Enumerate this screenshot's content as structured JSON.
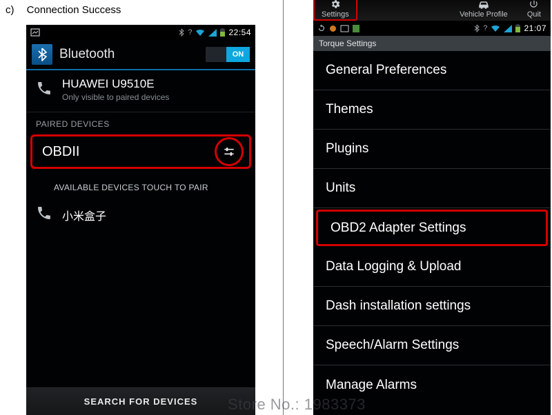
{
  "label": {
    "letter": "c)",
    "text": "Connection Success"
  },
  "dock": {
    "settings": "Settings",
    "vehicle": "Vehicle Profile",
    "quit": "Quit"
  },
  "left": {
    "status": {
      "time": "22:54"
    },
    "bt_title": "Bluetooth",
    "toggle": "ON",
    "visibility": {
      "name": "HUAWEI U9510E",
      "sub": "Only visible to paired devices"
    },
    "paired_label": "PAIRED DEVICES",
    "paired_name": "OBDII",
    "avail_label": "AVAILABLE DEVICES   TOUCH TO PAIR",
    "avail_name": "小米盒子",
    "search": "SEARCH FOR DEVICES"
  },
  "right": {
    "status": {
      "time": "21:07"
    },
    "header": "Torque Settings",
    "items": [
      "General Preferences",
      "Themes",
      "Plugins",
      "Units",
      "OBD2 Adapter Settings",
      "Data Logging & Upload",
      "Dash installation settings",
      "Speech/Alarm Settings",
      "Manage Alarms"
    ]
  },
  "watermark": "Store No.: 1983373"
}
